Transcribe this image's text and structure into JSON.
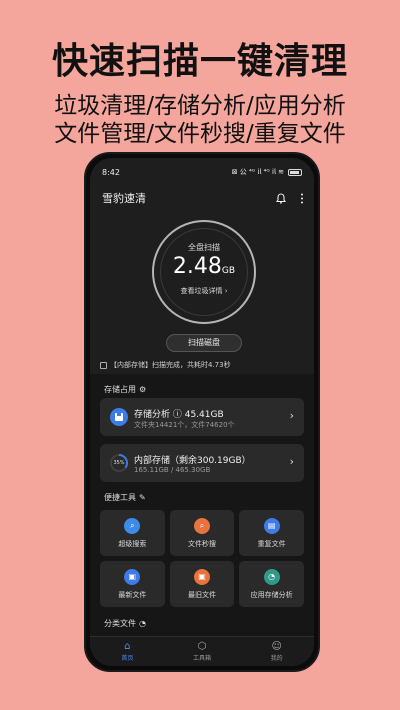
{
  "promo": {
    "headline": "快速扫描一键清理",
    "line1": "垃圾清理/存储分析/应用分析",
    "line2": "文件管理/文件秒搜/重复文件"
  },
  "status_bar": {
    "time": "8:42",
    "indicators": "⊠ 公 ⁴ᴳ 𝗂𝗅 ⁴ᴳ 𝗂𝗅 ≋"
  },
  "app": {
    "title": "雪豹速清",
    "scan_ring": {
      "label": "全盘扫描",
      "value": "2.48",
      "unit": "GB",
      "link": "查看垃圾详情 ›"
    },
    "scan_button": "扫描磁盘",
    "scan_status": "【内部存储】扫描完成，共耗时4.73秒",
    "storage_section": {
      "title": "存储占用",
      "analysis_card": {
        "title": "存储分析 ⓘ  45.41GB",
        "subtitle": "文件夹14421个，文件74620个",
        "icon_color": "#3d7be8"
      },
      "internal_card": {
        "title": "内部存储（剩余300.19GB）",
        "subtitle": "165.11GB / 465.30GB",
        "usage_percent": 35,
        "usage_label": "35%"
      }
    },
    "tools_section": {
      "title": "便捷工具",
      "items": [
        {
          "label": "超级搜索",
          "icon": "search-icon",
          "color": "#3d8be8",
          "glyph": "⌕"
        },
        {
          "label": "文件秒搜",
          "icon": "file-search-icon",
          "color": "#e8733d",
          "glyph": "⌕"
        },
        {
          "label": "重复文件",
          "icon": "duplicate-file-icon",
          "color": "#3d7be8",
          "glyph": "▤"
        },
        {
          "label": "最新文件",
          "icon": "recent-file-icon",
          "color": "#3d7be8",
          "glyph": "▣"
        },
        {
          "label": "最旧文件",
          "icon": "old-file-icon",
          "color": "#e8733d",
          "glyph": "▣"
        },
        {
          "label": "应用存储分析",
          "icon": "app-storage-icon",
          "color": "#2f9a8a",
          "glyph": "◔"
        }
      ]
    },
    "category_section": {
      "title": "分类文件"
    },
    "bottom_nav": [
      {
        "label": "首页",
        "icon": "home-icon",
        "glyph": "⌂",
        "active": true
      },
      {
        "label": "工具箱",
        "icon": "toolbox-icon",
        "glyph": "⬡",
        "active": false
      },
      {
        "label": "我的",
        "icon": "profile-icon",
        "glyph": "☺",
        "active": false
      }
    ]
  }
}
